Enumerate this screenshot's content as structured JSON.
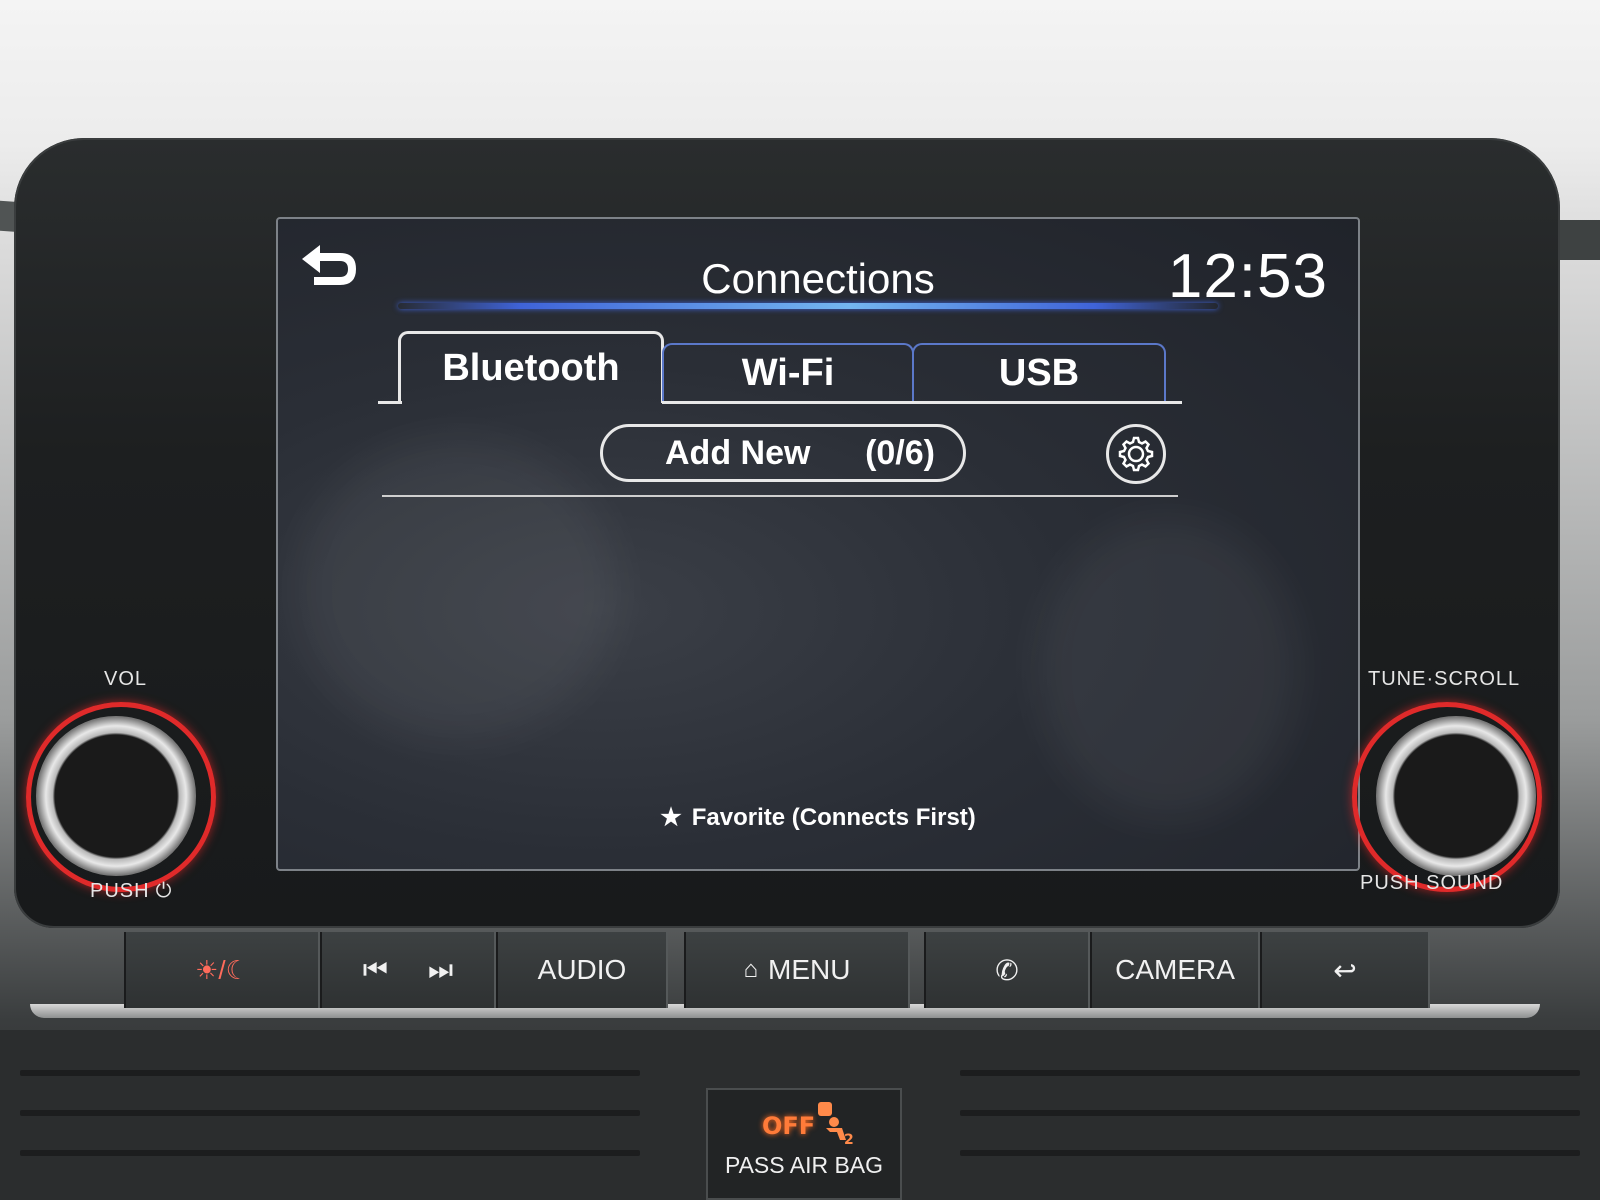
{
  "screen": {
    "title": "Connections",
    "clock": "12:53",
    "back_icon": "back-arrow-icon",
    "tabs": [
      {
        "label": "Bluetooth",
        "active": true
      },
      {
        "label": "Wi-Fi",
        "active": false
      },
      {
        "label": "USB",
        "active": false
      }
    ],
    "add_new": {
      "label": "Add New",
      "count": "(0/6)"
    },
    "settings_icon": "gear-icon",
    "favorite_note": "Favorite (Connects First)",
    "accent_color": "#3f63d8"
  },
  "knobs": {
    "left": {
      "top_label": "VOL",
      "bottom_label": "PUSH"
    },
    "right": {
      "top_label": "TUNE·SCROLL",
      "bottom_label": "PUSH SOUND"
    },
    "ring_color": "#e02a2a"
  },
  "hardware_buttons": [
    {
      "name": "day-night",
      "icon": "sun-moon-icon",
      "label": ""
    },
    {
      "name": "track",
      "icon": "prev-next-icon",
      "label": ""
    },
    {
      "name": "audio",
      "icon": "",
      "label": "AUDIO"
    },
    {
      "name": "menu",
      "icon": "home-icon",
      "label": "MENU"
    },
    {
      "name": "phone",
      "icon": "phone-icon",
      "label": ""
    },
    {
      "name": "camera",
      "icon": "",
      "label": "CAMERA"
    },
    {
      "name": "back",
      "icon": "back-arrow-icon",
      "label": ""
    }
  ],
  "airbag": {
    "status": "OFF",
    "label": "PASS AIR BAG",
    "indicator_color": "#ff7b39"
  }
}
